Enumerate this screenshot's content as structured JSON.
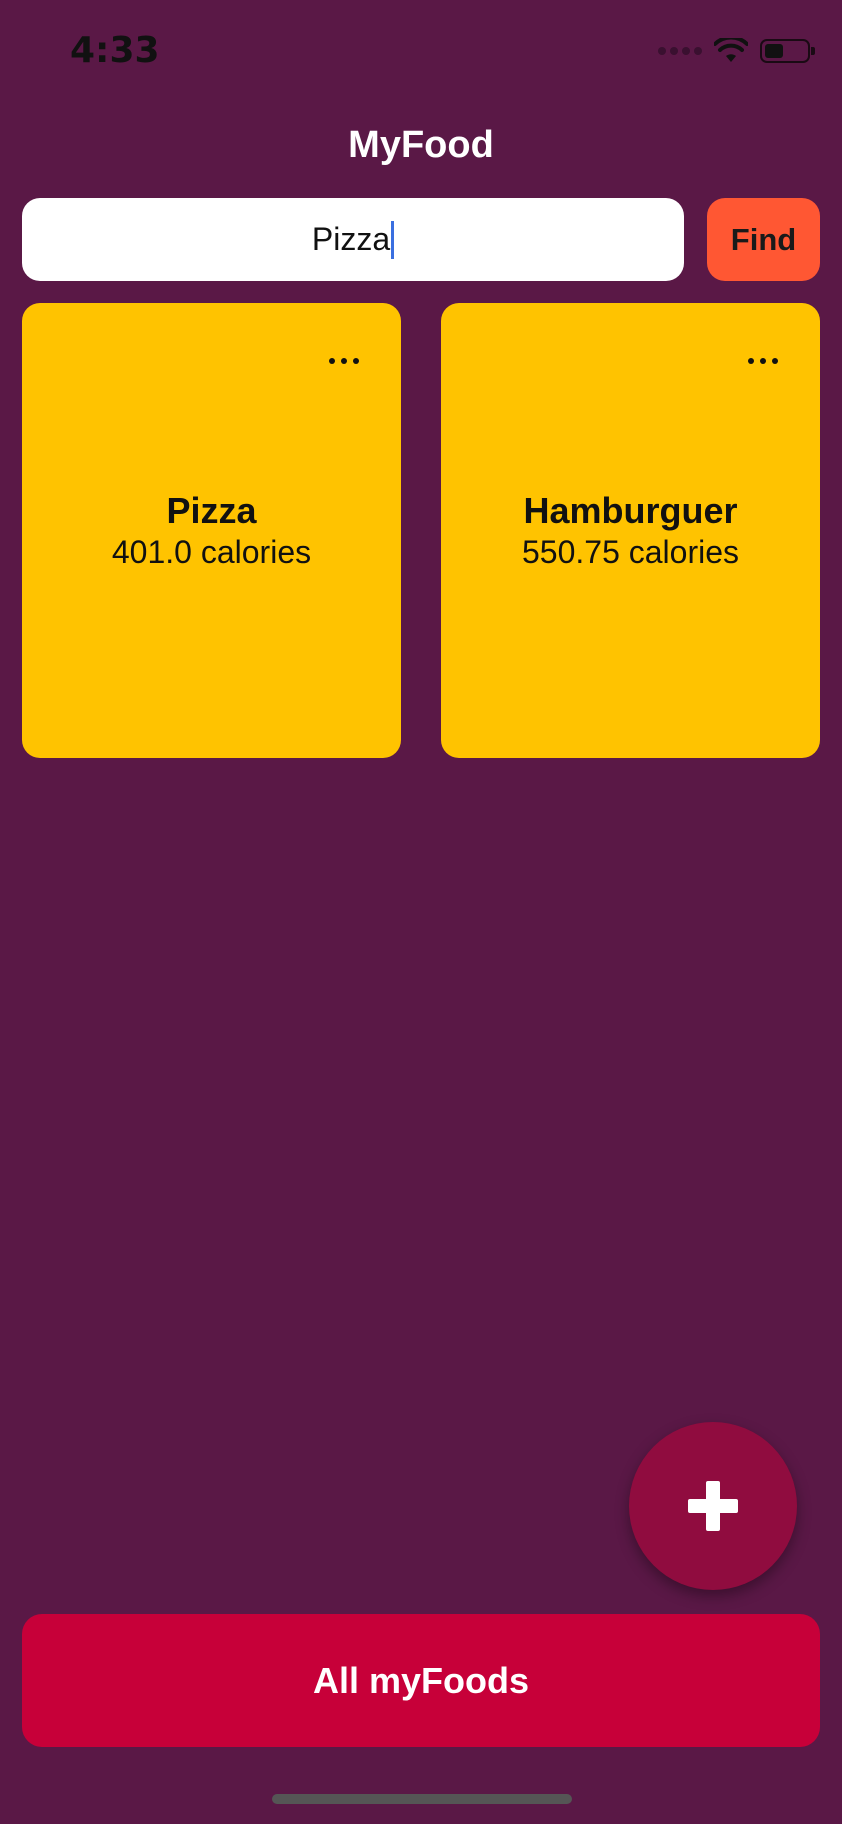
{
  "status_bar": {
    "time": "4:33"
  },
  "header": {
    "title": "MyFood"
  },
  "search": {
    "value": "Pizza",
    "button_label": "Find"
  },
  "foods": [
    {
      "name": "Pizza",
      "calories": "401.0 calories"
    },
    {
      "name": "Hamburguer",
      "calories": "550.75 calories"
    }
  ],
  "footer": {
    "all_button_label": "All myFoods"
  },
  "icons": {
    "fab": "plus-icon",
    "card_menu": "more-horizontal-icon",
    "wifi": "wifi-icon",
    "battery": "battery-icon",
    "signal": "cellular-signal-icon"
  },
  "colors": {
    "background": "#5a1846",
    "card": "#ffc300",
    "find_button": "#ff5733",
    "fab": "#900c3f",
    "all_button": "#c70039"
  },
  "device": {
    "battery_level": 0.45
  }
}
